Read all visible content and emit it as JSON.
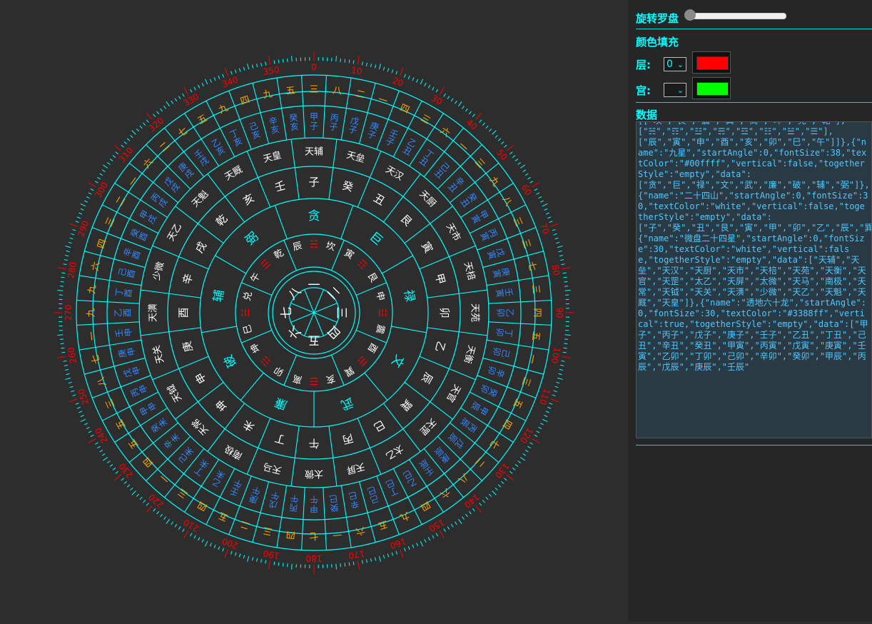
{
  "controls": {
    "rotate_label": "旋转罗盘",
    "fill_title": "颜色填充",
    "layer_label": "层:",
    "layer_value": "0",
    "palace_label": "宫:",
    "palace_value": "",
    "data_title": "数据",
    "layer_color": "#ff0000",
    "palace_color": "#00ff00",
    "slider_value": 0
  },
  "data_text": "[[\"坎\",\"艮\",\"震\",\"巽\",\"离\",\"坤\",\"兑\",\"乾\"],\n[\"☵\",\"☶\",\"☳\",\"☴\",\"☲\",\"☷\",\"☱\",\"☰\"],\n[\"辰\",\"寅\",\"申\",\"酉\",\"亥\",\"卯\",\"巳\",\"午\"]]},{\"name\":\"九星\",\"startAngle\":0,\"fontSize\":38,\"textColor\":\"#00ffff\",\"vertical\":false,\"togetherStyle\":\"empty\",\"data\":\n[\"贪\",\"巨\",\"禄\",\"文\",\"武\",\"廉\",\"破\",\"辅\",\"弼\"]},{\"name\":\"二十四山\",\"startAngle\":0,\"fontSize\":30,\"textColor\":\"white\",\"vertical\":false,\"togetherStyle\":\"empty\",\"data\":\n[\"子\",\"癸\",\"丑\",\"艮\",\"寅\",\"甲\",\"卯\",\"乙\",\"辰\",\"巽\",\"巳\",\"丙\",\"午\",\"丁\",\"未\",\"坤\",\"申\",\"庚\",\"酉\",\"辛\",\"戌\",\"乾\",\"亥\",\"壬\"]},{\"name\":\"微盘二十四星\",\"startAngle\":0,\"fontSize\":30,\"textColor\":\"white\",\"vertical\":false,\"togetherStyle\":\"empty\",\"data\":[\"天辅\",\"天垒\",\"天汉\",\"天厨\",\"天市\",\"天棓\",\"天苑\",\"天衡\",\"天官\",\"天罡\",\"太乙\",\"天屏\",\"太微\",\"天马\",\"南极\",\"天常\",\"天钺\",\"天关\",\"天潢\",\"少微\",\"天乙\",\"天魁\",\"天厩\",\"天皇\"]},{\"name\":\"透地六十龙\",\"startAngle\":0,\"fontSize\":30,\"textColor\":\"#3388ff\",\"vertical\":true,\"togetherStyle\":\"empty\",\"data\":[\"甲子\",\"丙子\",\"戊子\",\"庚子\",\"壬子\",\"乙丑\",\"丁丑\",\"己丑\",\"辛丑\",\"癸丑\",\"甲寅\",\"丙寅\",\"戊寅\",\"庚寅\",\"壬寅\",\"乙卯\",\"丁卯\",\"己卯\",\"辛卯\",\"癸卯\",\"甲辰\",\"丙辰\",\"戊辰\",\"庚辰\",\"壬辰\"",
  "compass": {
    "center_numbers": [
      "一",
      "二",
      "三",
      "四",
      "五",
      "六",
      "七",
      "八"
    ],
    "center_numbers_order": [
      "一",
      "二",
      "三",
      "四",
      "五",
      "六",
      "七",
      "八"
    ],
    "trigrams": [
      "坎",
      "艮",
      "震",
      "巽",
      "离",
      "坤",
      "兑",
      "乾"
    ],
    "trigram_symbols": [
      "☵",
      "☶",
      "☳",
      "☴",
      "☲",
      "☷",
      "☱",
      "☰"
    ],
    "branches": [
      "辰",
      "寅",
      "申",
      "酉",
      "亥",
      "卯",
      "巳",
      "午"
    ],
    "nine_stars": [
      "贪",
      "巨",
      "禄",
      "文",
      "武",
      "廉",
      "破",
      "辅",
      "弼"
    ],
    "mountains": [
      "子",
      "癸",
      "丑",
      "艮",
      "寅",
      "甲",
      "卯",
      "乙",
      "辰",
      "巽",
      "巳",
      "丙",
      "午",
      "丁",
      "未",
      "坤",
      "申",
      "庚",
      "酉",
      "辛",
      "戌",
      "乾",
      "亥",
      "壬"
    ],
    "stars24": [
      "天辅",
      "天垒",
      "天汉",
      "天厨",
      "天市",
      "天棓",
      "天苑",
      "天衡",
      "天官",
      "天罡",
      "太乙",
      "天屏",
      "太微",
      "天马",
      "南极",
      "天常",
      "天钺",
      "天关",
      "天潢",
      "少微",
      "天乙",
      "天魁",
      "天厩",
      "天皇"
    ],
    "dragons60": [
      "甲子",
      "丙子",
      "戊子",
      "庚子",
      "壬子",
      "乙丑",
      "丁丑",
      "己丑",
      "辛丑",
      "癸丑",
      "甲寅",
      "丙寅",
      "戊寅",
      "庚寅",
      "壬寅",
      "乙卯",
      "丁卯",
      "己卯",
      "辛卯",
      "癸卯",
      "甲辰",
      "丙辰",
      "戊辰",
      "庚辰",
      "壬辰",
      "乙巳",
      "丁巳",
      "己巳",
      "辛巳",
      "癸巳",
      "甲午",
      "丙午",
      "戊午",
      "庚午",
      "壬午",
      "乙未",
      "丁未",
      "己未",
      "辛未",
      "癸未",
      "甲申",
      "丙申",
      "戊申",
      "庚申",
      "壬申",
      "乙酉",
      "丁酉",
      "己酉",
      "辛酉",
      "癸酉",
      "甲戌",
      "丙戌",
      "戊戌",
      "庚戌",
      "壬戌",
      "乙亥",
      "丁亥",
      "己亥",
      "辛亥",
      "癸亥"
    ],
    "numbers_ring": [
      "三",
      "八",
      "二",
      "一",
      "四",
      "三",
      "六",
      "一",
      "三",
      "九",
      "八",
      "三",
      "三",
      "七",
      "三",
      "四",
      "五",
      "一",
      "三",
      "五",
      "四",
      "七",
      "二",
      "八",
      "六",
      "四",
      "九",
      "五",
      "六",
      "一",
      "七",
      "四",
      "三",
      "二",
      "五",
      "四",
      "三",
      "一",
      "四",
      "五",
      "五",
      "三",
      "八",
      "七",
      "一",
      "九",
      "九",
      "六",
      "四",
      "三",
      "二",
      "一",
      "六",
      "二",
      "七",
      "五",
      "九",
      "四",
      "九",
      "五"
    ],
    "degree_labels": [
      "0",
      "10",
      "20",
      "30",
      "40",
      "50",
      "60",
      "70",
      "80",
      "90",
      "100",
      "110",
      "120",
      "130",
      "140",
      "150",
      "160",
      "170",
      "180",
      "190",
      "200",
      "210",
      "220",
      "230",
      "240",
      "250",
      "260",
      "270",
      "280",
      "290",
      "300",
      "310",
      "320",
      "330",
      "340",
      "350"
    ],
    "colors": {
      "ring_line": "#00ffff",
      "degree_text": "#ff0000",
      "tick": "#00ffff",
      "dragon_text": "#3388ff",
      "number_text": "#ffa500",
      "star_text": "#00ffff",
      "white_text": "#ffffff",
      "trigram_symbol": "#ff0000"
    }
  }
}
